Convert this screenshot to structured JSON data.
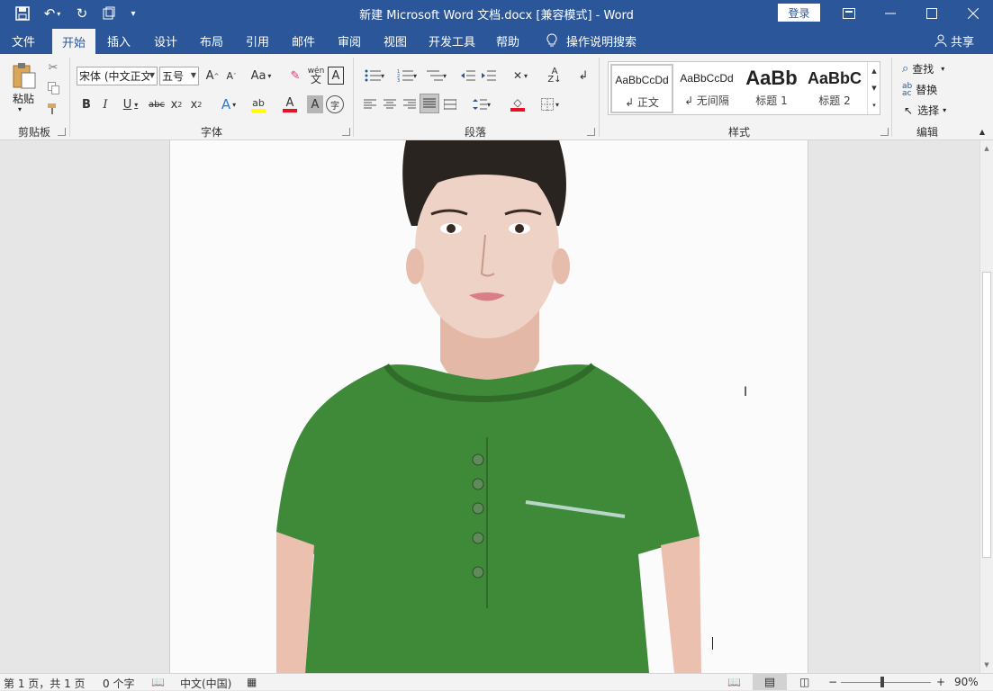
{
  "window": {
    "title": "新建 Microsoft Word 文档.docx [兼容模式]  -  Word",
    "login_label": "登录",
    "share_label": "共享"
  },
  "tabs": [
    "文件",
    "开始",
    "插入",
    "设计",
    "布局",
    "引用",
    "邮件",
    "审阅",
    "视图",
    "开发工具",
    "帮助"
  ],
  "tell_me": "操作说明搜索",
  "ribbon": {
    "clipboard": {
      "label": "剪贴板",
      "paste": "粘贴"
    },
    "font": {
      "label": "字体",
      "font_name": "宋体 (中文正文)",
      "font_size": "五号"
    },
    "paragraph": {
      "label": "段落"
    },
    "styles": {
      "label": "样式",
      "items": [
        {
          "preview": "AaBbCcDd",
          "name": "↲ 正文"
        },
        {
          "preview": "AaBbCcDd",
          "name": "↲ 无间隔"
        },
        {
          "preview": "AaBb",
          "name": "标题 1"
        },
        {
          "preview": "AaBbC",
          "name": "标题 2"
        }
      ]
    },
    "editing": {
      "label": "编辑",
      "find": "查找",
      "replace": "替换",
      "select": "选择"
    }
  },
  "status": {
    "page": "第 1 页，共 1 页",
    "words": "0 个字",
    "language": "中文(中国)",
    "zoom": "90%",
    "zoom_level": 0.9
  },
  "colors": {
    "accent": "#2b579a",
    "shirt": "#3e8a38",
    "highlight_yellow": "#ffff00",
    "font_red": "#e81123"
  }
}
